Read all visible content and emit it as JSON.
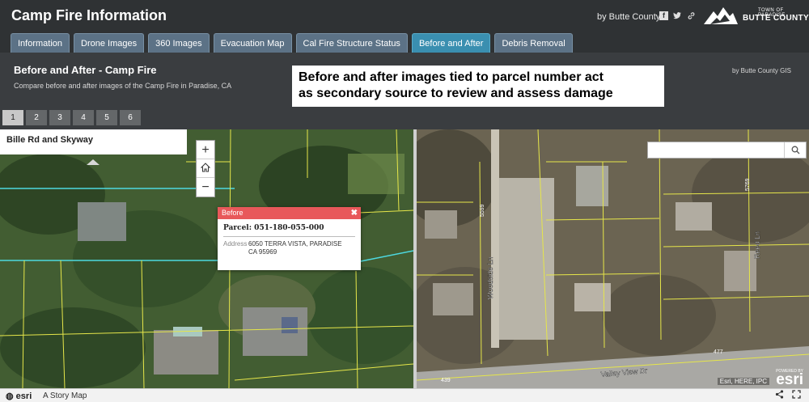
{
  "header": {
    "title": "Camp Fire Information",
    "byline": "by Butte County",
    "social_icons": [
      "facebook-icon",
      "twitter-icon",
      "link-icon"
    ],
    "logo": {
      "small": "TOWN OF PARADISE",
      "big": "BUTTE COUNTY"
    },
    "tabs": [
      {
        "label": "Information",
        "active": false
      },
      {
        "label": "Drone Images",
        "active": false
      },
      {
        "label": "360 Images",
        "active": false
      },
      {
        "label": "Evacuation Map",
        "active": false
      },
      {
        "label": "Cal Fire Structure Status",
        "active": false
      },
      {
        "label": "Before and After",
        "active": true
      },
      {
        "label": "Debris Removal",
        "active": false
      }
    ]
  },
  "subheader": {
    "title": "Before and After - Camp Fire",
    "description": "Compare before and after images of the Camp Fire in Paradise, CA",
    "credit": "by Butte County GIS",
    "callout_line1": "Before and after images tied to parcel number act",
    "callout_line2": "as secondary source to review and assess damage",
    "pages": [
      "1",
      "2",
      "3",
      "4",
      "5",
      "6"
    ],
    "active_page": "1"
  },
  "map": {
    "location_label": "Bille Rd and Skyway",
    "zoom_in": "+",
    "zoom_out": "−",
    "popup": {
      "title": "Before",
      "close": "✖",
      "parcel": "Parcel: 051-180-055-000",
      "address_label": "Address",
      "address_value": "6050 TERRA VISTA, PARADISE CA 95969"
    },
    "search_placeholder": "",
    "street_labels": [
      "Woodside Ln",
      "Valley View Dr",
      "Reed Ln",
      "5599",
      "5769",
      "439",
      "477"
    ],
    "attribution": "Esri, HERE, IPC",
    "esri_powered": "POWERED BY",
    "esri_word": "esri"
  },
  "footer": {
    "brand": "esri",
    "text": "A Story Map"
  },
  "colors": {
    "header_bg": "#2f3234",
    "tab_bg": "#5c7286",
    "tab_active": "#3a8fb0",
    "popup_header": "#e8585a",
    "parcel_lines": "#e6e64a",
    "cyan_lines": "#4dd9e0"
  }
}
